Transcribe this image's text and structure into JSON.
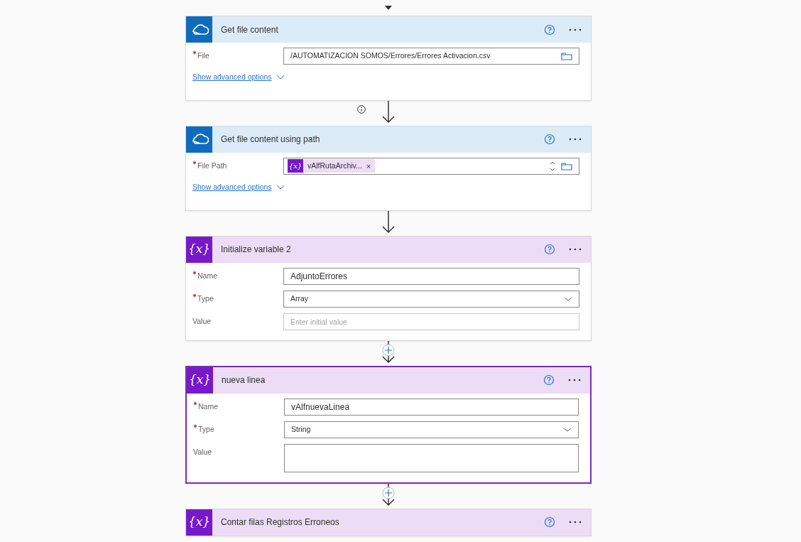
{
  "cards": [
    {
      "kind": "onedrive",
      "title": "Get file content",
      "selected": false,
      "fields": [
        {
          "label": "File",
          "required": true,
          "kind": "picker",
          "value": "/AUTOMATIZACION SOMOS/Errores/Errores Activacion.csv"
        }
      ],
      "advanced": "Show advanced options",
      "connector_info": true,
      "connector_add": false
    },
    {
      "kind": "onedrive",
      "title": "Get file content using path",
      "selected": false,
      "fields": [
        {
          "label": "File Path",
          "required": true,
          "kind": "token",
          "token": {
            "glyph": "{x}",
            "text": "vAlfRutaArchiv...",
            "remove": "×"
          }
        }
      ],
      "advanced": "Show advanced options",
      "connector_info": false,
      "connector_add": false
    },
    {
      "kind": "variable",
      "glyph": "{x}",
      "title": "Initialize variable 2",
      "selected": false,
      "fields": [
        {
          "label": "Name",
          "required": true,
          "kind": "text",
          "value": "AdjuntoErrores"
        },
        {
          "label": "Type",
          "required": true,
          "kind": "select",
          "value": "Array"
        },
        {
          "label": "Value",
          "required": false,
          "kind": "text",
          "placeholder": "Enter initial value"
        }
      ],
      "connector_info": false,
      "connector_add": true
    },
    {
      "kind": "variable",
      "glyph": "{x}",
      "title": "nueva linea",
      "selected": true,
      "fields": [
        {
          "label": "Name",
          "required": true,
          "kind": "text",
          "value": "vAlfnuevaLinea"
        },
        {
          "label": "Type",
          "required": true,
          "kind": "select",
          "value": "String"
        },
        {
          "label": "Value",
          "required": false,
          "kind": "textarea"
        }
      ],
      "connector_info": false,
      "connector_add": true
    },
    {
      "kind": "variable",
      "glyph": "{x}",
      "title": "Contar filas Registros Erroneos",
      "selected": false
    }
  ]
}
